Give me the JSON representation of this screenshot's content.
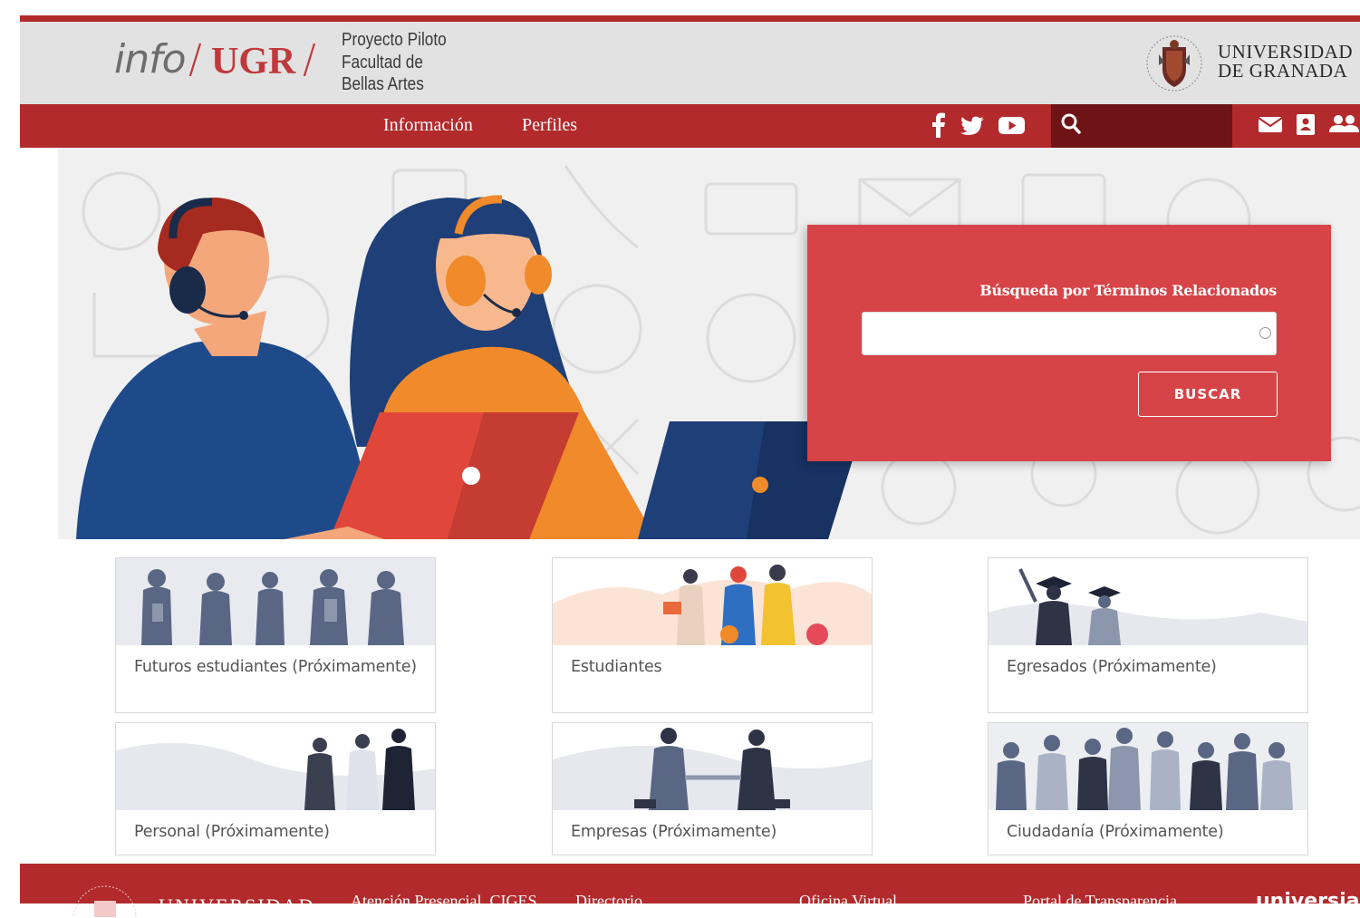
{
  "header": {
    "logo_info": "info",
    "logo_slash": "/",
    "logo_ugr": "UGR",
    "project_lines": [
      "Proyecto Piloto",
      "Facultad de",
      "Bellas Artes"
    ],
    "university_lines": [
      "UNIVERSIDAD",
      "DE GRANADA"
    ]
  },
  "nav": {
    "items": [
      "Información",
      "Perfiles"
    ],
    "social_icons": [
      "facebook-icon",
      "twitter-icon",
      "youtube-icon"
    ],
    "search_icon": "search-icon",
    "right_icons": [
      "mail-icon",
      "directory-icon",
      "users-icon"
    ]
  },
  "search": {
    "title": "Búsqueda por Términos Relacionados",
    "input_value": "",
    "button_label": "BUSCAR"
  },
  "cards": [
    {
      "label": "Futuros estudiantes (Próximamente)"
    },
    {
      "label": "Estudiantes"
    },
    {
      "label": "Egresados (Próximamente)"
    },
    {
      "label": "Personal (Próximamente)"
    },
    {
      "label": "Empresas (Próximamente)"
    },
    {
      "label": "Ciudadanía (Próximamente)"
    }
  ],
  "footer": {
    "university": "UNIVERSIDAD",
    "links": [
      "Atención Presencial, CIGES",
      "Directorio",
      "Oficina Virtual",
      "Portal de Transparencia"
    ],
    "brand": "universia"
  },
  "colors": {
    "brand_red": "#b22a2c",
    "dark_red": "#6f1416",
    "search_panel": "#d64448",
    "header_grey": "#e2e2e2"
  }
}
